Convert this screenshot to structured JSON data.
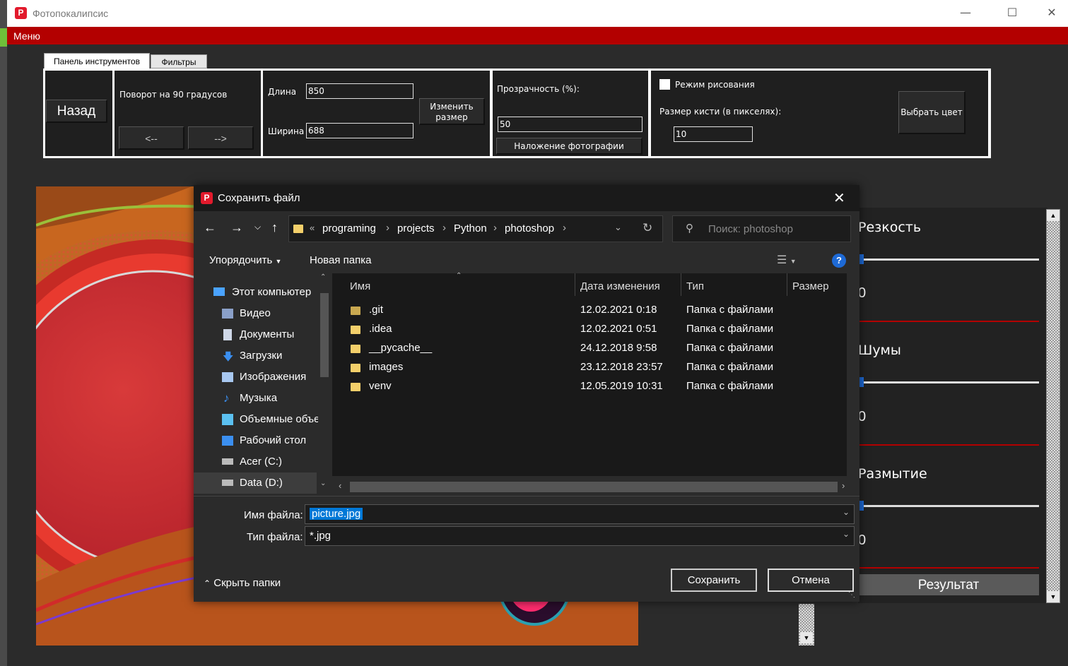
{
  "app": {
    "title": "Фотопокалипсис",
    "menu_label": "Меню",
    "tabs": [
      "Панель инструментов",
      "Фильтры"
    ],
    "toolbar": {
      "back_label": "Назад",
      "rotate_label": "Поворот на 90 градусов",
      "rotate_left": "<--",
      "rotate_right": "-->",
      "length_label": "Длина",
      "length_value": "850",
      "width_label": "Ширина",
      "width_value": "688",
      "resize_label": "Изменить размер",
      "opacity_label": "Прозрачность (%):",
      "opacity_value": "50",
      "overlay_label": "Наложение фотографии",
      "draw_mode_label": "Режим рисования",
      "brush_size_label": "Размер кисти (в пикселях):",
      "brush_size_value": "10",
      "color_label": "Выбрать цвет"
    },
    "right_panel": {
      "sections": [
        {
          "title": "Резкость",
          "value": "0"
        },
        {
          "title": "Шумы",
          "value": "0"
        },
        {
          "title": "Размытие",
          "value": "0"
        }
      ],
      "result_label": "Результат"
    }
  },
  "dialog": {
    "title": "Сохранить файл",
    "path": [
      "«",
      "programing",
      "projects",
      "Python",
      "photoshop"
    ],
    "search_placeholder": "Поиск: photoshop",
    "organize_label": "Упорядочить",
    "new_folder_label": "Новая папка",
    "help_label": "?",
    "nav_items": [
      {
        "label": "Этот компьютер",
        "icon": "computer-icon",
        "color": "#4aa3ff"
      },
      {
        "label": "Видео",
        "icon": "video-icon",
        "color": "#8aa0c8"
      },
      {
        "label": "Документы",
        "icon": "documents-icon",
        "color": "#cfd8e8"
      },
      {
        "label": "Загрузки",
        "icon": "downloads-icon",
        "color": "#3b8ff0"
      },
      {
        "label": "Изображения",
        "icon": "images-icon",
        "color": "#a8c8f0"
      },
      {
        "label": "Музыка",
        "icon": "music-icon",
        "color": "#3b8ff0"
      },
      {
        "label": "Объемные объекты",
        "icon": "3d-objects-icon",
        "color": "#5bc0f0"
      },
      {
        "label": "Рабочий стол",
        "icon": "desktop-icon",
        "color": "#3b8ff0"
      },
      {
        "label": "Acer (C:)",
        "icon": "drive-icon",
        "color": "#bbbbbb"
      },
      {
        "label": "Data (D:)",
        "icon": "drive-icon",
        "color": "#bbbbbb"
      }
    ],
    "columns": [
      "Имя",
      "Дата изменения",
      "Тип",
      "Размер"
    ],
    "files": [
      {
        "name": ".git",
        "date": "12.02.2021 0:18",
        "type": "Папка с файлами",
        "size": ""
      },
      {
        "name": ".idea",
        "date": "12.02.2021 0:51",
        "type": "Папка с файлами",
        "size": ""
      },
      {
        "name": "__pycache__",
        "date": "24.12.2018 9:58",
        "type": "Папка с файлами",
        "size": ""
      },
      {
        "name": "images",
        "date": "23.12.2018 23:57",
        "type": "Папка с файлами",
        "size": ""
      },
      {
        "name": "venv",
        "date": "12.05.2019 10:31",
        "type": "Папка с файлами",
        "size": ""
      }
    ],
    "filename_label": "Имя файла:",
    "filename_value": "picture.jpg",
    "filetype_label": "Тип файла:",
    "filetype_value": "*.jpg",
    "hide_folders_label": "Скрыть папки",
    "save_label": "Сохранить",
    "cancel_label": "Отмена"
  },
  "colors": {
    "accent": "#b30000",
    "logo": "#e21a2c",
    "selection": "#0078d7"
  }
}
